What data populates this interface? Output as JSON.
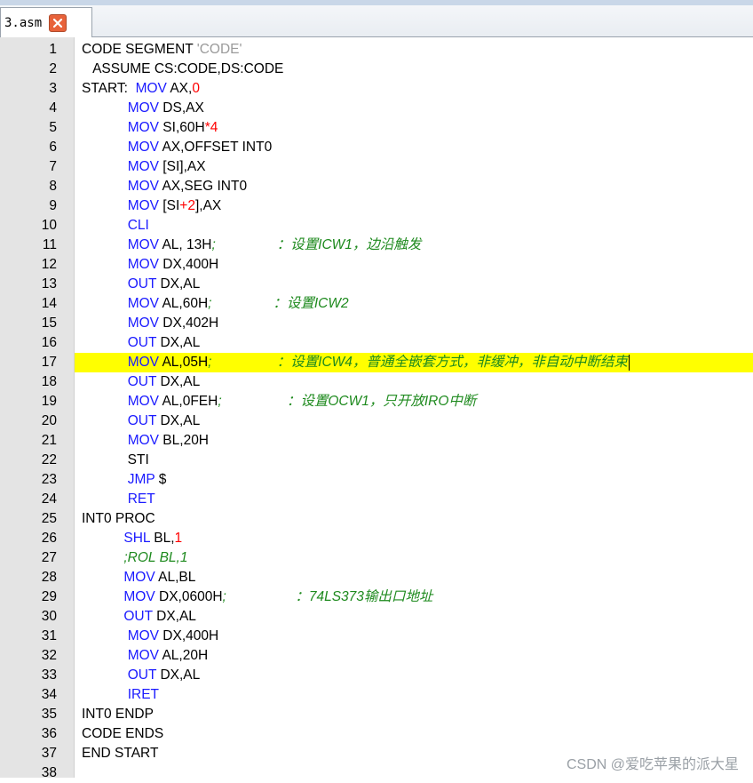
{
  "tab": {
    "label": "3.asm",
    "close_icon": "close-x-icon"
  },
  "watermark": "CSDN @爱吃苹果的派大星",
  "colors": {
    "keyword": "#1a1aff",
    "number": "#ff0000",
    "string": "#9a9a9a",
    "comment": "#1e8a1e",
    "highlight": "#ffff00"
  },
  "lines": [
    {
      "n": "1",
      "segs": [
        {
          "t": "CODE SEGMENT ",
          "c": ""
        },
        {
          "t": "'CODE'",
          "c": "s"
        }
      ]
    },
    {
      "n": "2",
      "segs": [
        {
          "t": "   ASSUME CS:CODE,DS:CODE",
          "c": ""
        }
      ]
    },
    {
      "n": "3",
      "segs": [
        {
          "t": "START:  ",
          "c": ""
        },
        {
          "t": "MOV",
          "c": "k"
        },
        {
          "t": " AX,",
          "c": ""
        },
        {
          "t": "0",
          "c": "n"
        }
      ]
    },
    {
      "n": "4",
      "segs": [
        {
          "t": "            ",
          "c": ""
        },
        {
          "t": "MOV",
          "c": "k"
        },
        {
          "t": " DS,AX",
          "c": ""
        }
      ]
    },
    {
      "n": "5",
      "segs": [
        {
          "t": "            ",
          "c": ""
        },
        {
          "t": "MOV",
          "c": "k"
        },
        {
          "t": " SI,60H",
          "c": ""
        },
        {
          "t": "*4",
          "c": "n"
        }
      ]
    },
    {
      "n": "6",
      "segs": [
        {
          "t": "            ",
          "c": ""
        },
        {
          "t": "MOV",
          "c": "k"
        },
        {
          "t": " AX,OFFSET INT0",
          "c": ""
        }
      ]
    },
    {
      "n": "7",
      "segs": [
        {
          "t": "            ",
          "c": ""
        },
        {
          "t": "MOV",
          "c": "k"
        },
        {
          "t": " [SI],AX",
          "c": ""
        }
      ]
    },
    {
      "n": "8",
      "segs": [
        {
          "t": "            ",
          "c": ""
        },
        {
          "t": "MOV",
          "c": "k"
        },
        {
          "t": " AX,SEG INT0",
          "c": ""
        }
      ]
    },
    {
      "n": "9",
      "segs": [
        {
          "t": "            ",
          "c": ""
        },
        {
          "t": "MOV",
          "c": "k"
        },
        {
          "t": " [SI",
          "c": ""
        },
        {
          "t": "+2",
          "c": "n"
        },
        {
          "t": "],AX",
          "c": ""
        }
      ]
    },
    {
      "n": "10",
      "segs": [
        {
          "t": "            ",
          "c": ""
        },
        {
          "t": "CLI",
          "c": "k"
        }
      ]
    },
    {
      "n": "11",
      "segs": [
        {
          "t": "            ",
          "c": ""
        },
        {
          "t": "MOV",
          "c": "k"
        },
        {
          "t": " AL, 13H",
          "c": ""
        },
        {
          "t": ";                ：设置ICW1，边沿触发",
          "c": "c"
        }
      ]
    },
    {
      "n": "12",
      "segs": [
        {
          "t": "            ",
          "c": ""
        },
        {
          "t": "MOV",
          "c": "k"
        },
        {
          "t": " DX,400H",
          "c": ""
        }
      ]
    },
    {
      "n": "13",
      "segs": [
        {
          "t": "            ",
          "c": ""
        },
        {
          "t": "OUT",
          "c": "k"
        },
        {
          "t": " DX,AL",
          "c": ""
        }
      ]
    },
    {
      "n": "14",
      "segs": [
        {
          "t": "            ",
          "c": ""
        },
        {
          "t": "MOV",
          "c": "k"
        },
        {
          "t": " AL,60H",
          "c": ""
        },
        {
          "t": ";                ：设置ICW2",
          "c": "c"
        }
      ]
    },
    {
      "n": "15",
      "segs": [
        {
          "t": "            ",
          "c": ""
        },
        {
          "t": "MOV",
          "c": "k"
        },
        {
          "t": " DX,402H",
          "c": ""
        }
      ]
    },
    {
      "n": "16",
      "segs": [
        {
          "t": "            ",
          "c": ""
        },
        {
          "t": "OUT",
          "c": "k"
        },
        {
          "t": " DX,AL",
          "c": ""
        }
      ]
    },
    {
      "n": "17",
      "hl": true,
      "caret": true,
      "segs": [
        {
          "t": "            ",
          "c": ""
        },
        {
          "t": "MOV",
          "c": "k"
        },
        {
          "t": " AL,05H",
          "c": ""
        },
        {
          "t": ";                 ：设置ICW4，普通全嵌套方式，非缓冲，非自动中断结束",
          "c": "c"
        }
      ]
    },
    {
      "n": "18",
      "segs": [
        {
          "t": "            ",
          "c": ""
        },
        {
          "t": "OUT",
          "c": "k"
        },
        {
          "t": " DX,AL",
          "c": ""
        }
      ]
    },
    {
      "n": "19",
      "segs": [
        {
          "t": "            ",
          "c": ""
        },
        {
          "t": "MOV",
          "c": "k"
        },
        {
          "t": " AL,0FEH",
          "c": ""
        },
        {
          "t": ";                 ：设置OCW1，只开放IRO中断",
          "c": "c"
        }
      ]
    },
    {
      "n": "20",
      "segs": [
        {
          "t": "            ",
          "c": ""
        },
        {
          "t": "OUT",
          "c": "k"
        },
        {
          "t": " DX,AL",
          "c": ""
        }
      ]
    },
    {
      "n": "21",
      "segs": [
        {
          "t": "            ",
          "c": ""
        },
        {
          "t": "MOV",
          "c": "k"
        },
        {
          "t": " BL,20H",
          "c": ""
        }
      ]
    },
    {
      "n": "22",
      "segs": [
        {
          "t": "            STI",
          "c": ""
        }
      ]
    },
    {
      "n": "23",
      "segs": [
        {
          "t": "            ",
          "c": ""
        },
        {
          "t": "JMP",
          "c": "k"
        },
        {
          "t": " $",
          "c": ""
        }
      ]
    },
    {
      "n": "24",
      "segs": [
        {
          "t": "            ",
          "c": ""
        },
        {
          "t": "RET",
          "c": "k"
        }
      ]
    },
    {
      "n": "25",
      "segs": [
        {
          "t": "INT0 PROC",
          "c": ""
        }
      ]
    },
    {
      "n": "26",
      "segs": [
        {
          "t": "           ",
          "c": ""
        },
        {
          "t": "SHL",
          "c": "k"
        },
        {
          "t": " BL,",
          "c": ""
        },
        {
          "t": "1",
          "c": "n"
        }
      ]
    },
    {
      "n": "27",
      "segs": [
        {
          "t": "           ",
          "c": ""
        },
        {
          "t": ";ROL BL,1",
          "c": "c"
        }
      ]
    },
    {
      "n": "28",
      "segs": [
        {
          "t": "           ",
          "c": ""
        },
        {
          "t": "MOV",
          "c": "k"
        },
        {
          "t": " AL,BL",
          "c": ""
        }
      ]
    },
    {
      "n": "29",
      "segs": [
        {
          "t": "           ",
          "c": ""
        },
        {
          "t": "MOV",
          "c": "k"
        },
        {
          "t": " DX,0600H",
          "c": ""
        },
        {
          "t": ";                  ：74LS373输出口地址",
          "c": "c"
        }
      ]
    },
    {
      "n": "30",
      "segs": [
        {
          "t": "           ",
          "c": ""
        },
        {
          "t": "OUT",
          "c": "k"
        },
        {
          "t": " DX,AL",
          "c": ""
        }
      ]
    },
    {
      "n": "31",
      "segs": [
        {
          "t": "            ",
          "c": ""
        },
        {
          "t": "MOV",
          "c": "k"
        },
        {
          "t": " DX,400H",
          "c": ""
        }
      ]
    },
    {
      "n": "32",
      "segs": [
        {
          "t": "            ",
          "c": ""
        },
        {
          "t": "MOV",
          "c": "k"
        },
        {
          "t": " AL,20H",
          "c": ""
        }
      ]
    },
    {
      "n": "33",
      "segs": [
        {
          "t": "            ",
          "c": ""
        },
        {
          "t": "OUT",
          "c": "k"
        },
        {
          "t": " DX,AL",
          "c": ""
        }
      ]
    },
    {
      "n": "34",
      "segs": [
        {
          "t": "            ",
          "c": ""
        },
        {
          "t": "IRET",
          "c": "k"
        }
      ]
    },
    {
      "n": "35",
      "segs": [
        {
          "t": "INT0 ENDP",
          "c": ""
        }
      ]
    },
    {
      "n": "36",
      "segs": [
        {
          "t": "CODE ENDS",
          "c": ""
        }
      ]
    },
    {
      "n": "37",
      "segs": [
        {
          "t": "END START",
          "c": ""
        }
      ]
    },
    {
      "n": "38",
      "segs": [
        {
          "t": "",
          "c": ""
        }
      ]
    }
  ]
}
